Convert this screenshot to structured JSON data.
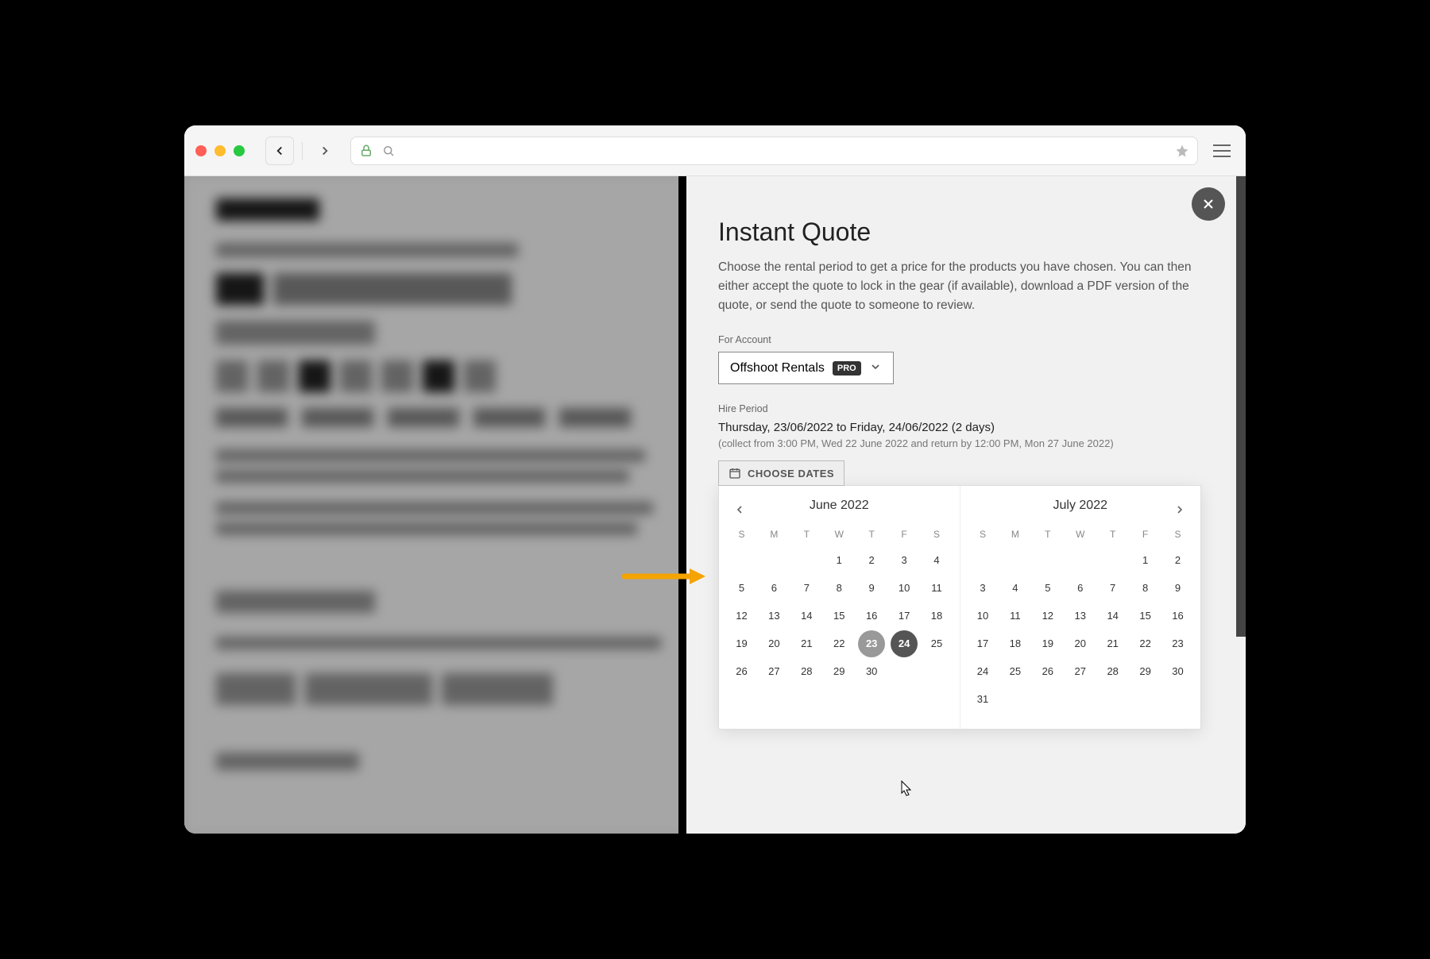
{
  "panel": {
    "title": "Instant Quote",
    "description": "Choose the rental period to get a price for the products you have chosen. You can then either accept the quote to lock in the gear (if available), download a PDF version of the quote, or send the quote to someone to review.",
    "account_label": "For Account",
    "account_name": "Offshoot Rentals",
    "account_badge": "PRO",
    "hire_label": "Hire Period",
    "hire_period_main": "Thursday, 23/06/2022 to Friday, 24/06/2022 (2 days)",
    "hire_period_sub": "(collect from 3:00 PM, Wed 22 June 2022 and return by 12:00 PM, Mon 27 June 2022)",
    "choose_dates_label": "CHOOSE DATES"
  },
  "calendar": {
    "day_headers": [
      "S",
      "M",
      "T",
      "W",
      "T",
      "F",
      "S"
    ],
    "months": [
      {
        "title": "June 2022",
        "nav_prev": true,
        "nav_next": false,
        "lead_blanks": 3,
        "days": 30,
        "sel_start": 23,
        "sel_end": 24
      },
      {
        "title": "July 2022",
        "nav_prev": false,
        "nav_next": true,
        "lead_blanks": 5,
        "days": 31,
        "sel_start": null,
        "sel_end": null
      }
    ]
  }
}
